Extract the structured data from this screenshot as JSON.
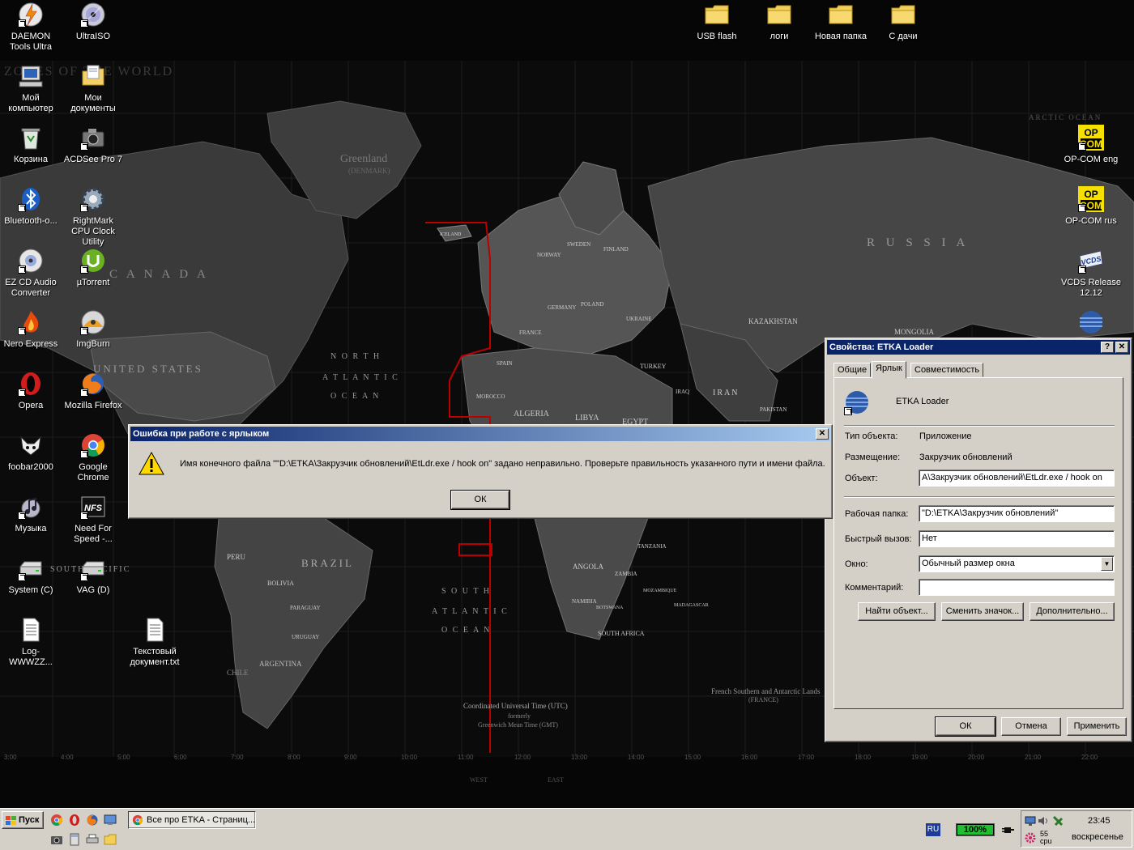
{
  "map": {
    "title_text": "ZONES OF THE WORLD",
    "regions": [
      "Greenland",
      "(DENMARK)",
      "C A N A D A",
      "UNITED STATES",
      "R U S S I A",
      "BRAZIL",
      "ALGERIA",
      "LIBYA",
      "EGYPT",
      "IRAN",
      "KAZAKHSTAN",
      "MONGOLIA",
      "ARGENTINA",
      "PERU",
      "BOLIVIA",
      "CHILE",
      "ANGOLA",
      "TURKEY",
      "UKRAINE",
      "FINLAND",
      "NORWAY",
      "SWEDEN",
      "ICELAND",
      "MOROCCO",
      "SPAIN",
      "FRANCE",
      "POLAND",
      "GERMANY",
      "IRAQ",
      "PAKISTAN",
      "TANZANIA",
      "ZAMBIA",
      "NAMIBIA",
      "BOTSWANA",
      "MADAGASCAR",
      "MOZAMBIQUE",
      "SOUTH AFRICA",
      "PARAGUAY",
      "URUGUAY"
    ],
    "oceans": [
      "N O R T H",
      "A T L A N T I C",
      "O C E A N",
      "S O U T H",
      "A T L A N T I C",
      "O C E A N",
      "SOUTH PACIFIC",
      "ARCTIC OCEAN"
    ],
    "utc_line1": "Coordinated Universal Time (UTC)",
    "utc_line2": "formerly",
    "utc_line3": "Greenwich Mean Time (GMT)",
    "times": [
      "3:00",
      "4:00",
      "5:00",
      "6:00",
      "7:00",
      "8:00",
      "9:00",
      "10:00",
      "11:00",
      "12:00",
      "13:00",
      "14:00",
      "15:00",
      "16:00",
      "17:00",
      "18:00",
      "19:00",
      "20:00",
      "21:00",
      "22:00"
    ],
    "west": "WEST",
    "east": "EAST",
    "antarctic": "French Southern and Antarctic Lands",
    "antarctic2": "(FRANCE)"
  },
  "desktop_icons": {
    "daemon": "DAEMON Tools Ultra",
    "ultraiso": "UltraISO",
    "mycomputer": "Мой компьютер",
    "mydocs": "Мои документы",
    "recycle": "Корзина",
    "acdsee": "ACDSee Pro 7",
    "bluetooth": "Bluetooth-о...",
    "rightmark": "RightMark CPU Clock Utility",
    "ezcd": "EZ CD Audio Converter",
    "utorrent": "µTorrent",
    "nero": "Nero Express",
    "imgburn": "ImgBurn",
    "opera": "Opera",
    "firefox": "Mozilla Firefox",
    "foobar": "foobar2000",
    "chrome": "Google Chrome",
    "music": "Музыка",
    "nfs": "Need For Speed -...",
    "systemc": "System (C)",
    "vagd": "VAG (D)",
    "log": "Log-WWWZZ...",
    "textdoc": "Текстовый документ.txt",
    "usbflash": "USB flash",
    "logi": "логи",
    "newfolder": "Новая папка",
    "sdachi": "С дачи",
    "opcom_eng": "OP-COM eng",
    "opcom_rus": "OP-COM rus",
    "vcds": "VCDS Release 12.12",
    "opcom_badge": "OP COM",
    "vcds_badge": "VCDS",
    "nfs_badge": "NFS"
  },
  "props_window": {
    "title": "Свойства: ETKA Loader",
    "help_btn": "?",
    "close_btn": "✕",
    "tabs": [
      "Общие",
      "Ярлык",
      "Совместимость"
    ],
    "app_name": "ETKA Loader",
    "labels": {
      "type": "Тип объекта:",
      "location": "Размещение:",
      "target": "Объект:",
      "workdir": "Рабочая папка:",
      "hotkey": "Быстрый вызов:",
      "window": "Окно:",
      "comment": "Комментарий:"
    },
    "values": {
      "type": "Приложение",
      "location": "Закрузчик обновлений",
      "target": "A\\Закрузчик обновлений\\EtLdr.exe / hook on",
      "workdir": "\"D:\\ETKA\\Закрузчик обновлений\"",
      "hotkey": "Нет",
      "window": "Обычный размер окна",
      "comment": ""
    },
    "buttons": {
      "find": "Найти объект...",
      "change_icon": "Сменить значок...",
      "advanced": "Дополнительно...",
      "ok": "ОК",
      "cancel": "Отмена",
      "apply": "Применить"
    }
  },
  "error_dialog": {
    "title": "Ошибка при работе с ярлыком",
    "close_btn": "✕",
    "message": "Имя конечного файла \"\"D:\\ETKA\\Закрузчик обновлений\\EtLdr.exe / hook on\" задано неправильно. Проверьте правильность указанного пути и имени файла.",
    "ok": "ОК"
  },
  "taskbar": {
    "start": "Пуск",
    "task_label": "Все про ETKA - Страниц...",
    "lang": "RU",
    "battery": "100%",
    "cpu_value": "55",
    "cpu_label": "cpu",
    "time": "23:45",
    "day": "воскресенье"
  },
  "colors": {
    "title_active_start": "#0a246a",
    "title_active_end": "#a6caf0",
    "face": "#d4d0c8",
    "desktop": "#050505",
    "battery_green": "#1fbf2f"
  }
}
